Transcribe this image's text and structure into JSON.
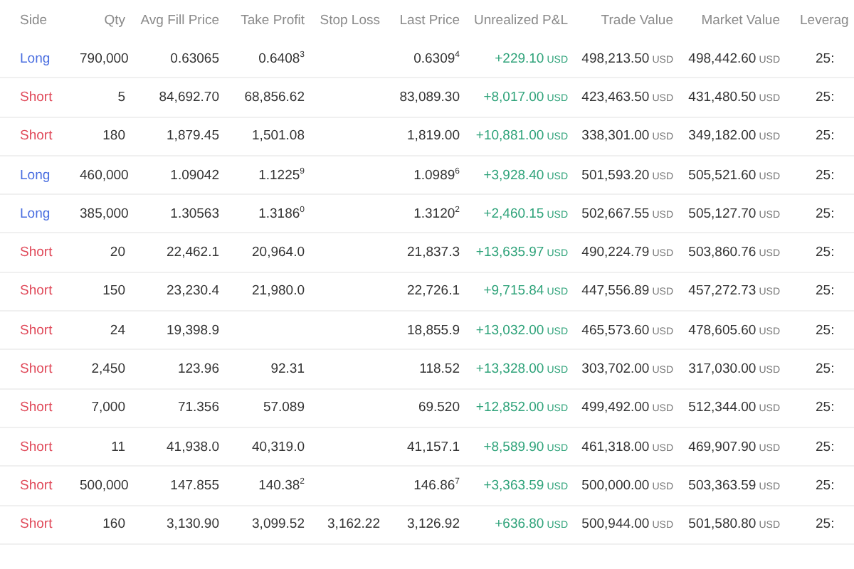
{
  "table": {
    "columns": [
      "Side",
      "Qty",
      "Avg Fill Price",
      "Take Profit",
      "Stop Loss",
      "Last Price",
      "Unrealized P&L",
      "Trade Value",
      "Market Value",
      "Leverag"
    ],
    "rows": [
      {
        "side": "Long",
        "kind": "long",
        "qty": "790,000",
        "avg_fill": "0.63065",
        "take_profit": "0.6408$^{3}$",
        "stop_loss": "",
        "last_price": "0.6309$^{4}$",
        "pnl": "+229.10",
        "pnl_currency": "USD",
        "trade_value": "498,213.50",
        "trade_currency": "USD",
        "market_value": "498,442.60",
        "market_currency": "USD",
        "leverage": "25:"
      },
      {
        "side": "Short",
        "kind": "short",
        "qty": "5",
        "avg_fill": "84,692.70",
        "take_profit": "68,856.62",
        "stop_loss": "",
        "last_price": "83,089.30",
        "pnl": "+8,017.00",
        "pnl_currency": "USD",
        "trade_value": "423,463.50",
        "trade_currency": "USD",
        "market_value": "431,480.50",
        "market_currency": "USD",
        "leverage": "25:"
      },
      {
        "side": "Short",
        "kind": "short",
        "qty": "180",
        "avg_fill": "1,879.45",
        "take_profit": "1,501.08",
        "stop_loss": "",
        "last_price": "1,819.00",
        "pnl": "+10,881.00",
        "pnl_currency": "USD",
        "trade_value": "338,301.00",
        "trade_currency": "USD",
        "market_value": "349,182.00",
        "market_currency": "USD",
        "leverage": "25:"
      },
      {
        "side": "Long",
        "kind": "long",
        "qty": "460,000",
        "avg_fill": "1.09042",
        "take_profit": "1.1225$^{9}$",
        "stop_loss": "",
        "last_price": "1.0989$^{6}$",
        "pnl": "+3,928.40",
        "pnl_currency": "USD",
        "trade_value": "501,593.20",
        "trade_currency": "USD",
        "market_value": "505,521.60",
        "market_currency": "USD",
        "leverage": "25:"
      },
      {
        "side": "Long",
        "kind": "long",
        "qty": "385,000",
        "avg_fill": "1.30563",
        "take_profit": "1.3186$^{0}$",
        "stop_loss": "",
        "last_price": "1.3120$^{2}$",
        "pnl": "+2,460.15",
        "pnl_currency": "USD",
        "trade_value": "502,667.55",
        "trade_currency": "USD",
        "market_value": "505,127.70",
        "market_currency": "USD",
        "leverage": "25:"
      },
      {
        "side": "Short",
        "kind": "short",
        "qty": "20",
        "avg_fill": "22,462.1",
        "take_profit": "20,964.0",
        "stop_loss": "",
        "last_price": "21,837.3",
        "pnl": "+13,635.97",
        "pnl_currency": "USD",
        "trade_value": "490,224.79",
        "trade_currency": "USD",
        "market_value": "503,860.76",
        "market_currency": "USD",
        "leverage": "25:"
      },
      {
        "side": "Short",
        "kind": "short",
        "qty": "150",
        "avg_fill": "23,230.4",
        "take_profit": "21,980.0",
        "stop_loss": "",
        "last_price": "22,726.1",
        "pnl": "+9,715.84",
        "pnl_currency": "USD",
        "trade_value": "447,556.89",
        "trade_currency": "USD",
        "market_value": "457,272.73",
        "market_currency": "USD",
        "leverage": "25:"
      },
      {
        "side": "Short",
        "kind": "short",
        "qty": "24",
        "avg_fill": "19,398.9",
        "take_profit": "",
        "stop_loss": "",
        "last_price": "18,855.9",
        "pnl": "+13,032.00",
        "pnl_currency": "USD",
        "trade_value": "465,573.60",
        "trade_currency": "USD",
        "market_value": "478,605.60",
        "market_currency": "USD",
        "leverage": "25:"
      },
      {
        "side": "Short",
        "kind": "short",
        "qty": "2,450",
        "avg_fill": "123.96",
        "take_profit": "92.31",
        "stop_loss": "",
        "last_price": "118.52",
        "pnl": "+13,328.00",
        "pnl_currency": "USD",
        "trade_value": "303,702.00",
        "trade_currency": "USD",
        "market_value": "317,030.00",
        "market_currency": "USD",
        "leverage": "25:"
      },
      {
        "side": "Short",
        "kind": "short",
        "qty": "7,000",
        "avg_fill": "71.356",
        "take_profit": "57.089",
        "stop_loss": "",
        "last_price": "69.520",
        "pnl": "+12,852.00",
        "pnl_currency": "USD",
        "trade_value": "499,492.00",
        "trade_currency": "USD",
        "market_value": "512,344.00",
        "market_currency": "USD",
        "leverage": "25:"
      },
      {
        "side": "Short",
        "kind": "short",
        "qty": "11",
        "avg_fill": "41,938.0",
        "take_profit": "40,319.0",
        "stop_loss": "",
        "last_price": "41,157.1",
        "pnl": "+8,589.90",
        "pnl_currency": "USD",
        "trade_value": "461,318.00",
        "trade_currency": "USD",
        "market_value": "469,907.90",
        "market_currency": "USD",
        "leverage": "25:"
      },
      {
        "side": "Short",
        "kind": "short",
        "qty": "500,000",
        "avg_fill": "147.855",
        "take_profit": "140.38$^{2}$",
        "stop_loss": "",
        "last_price": "146.86$^{7}$",
        "pnl": "+3,363.59",
        "pnl_currency": "USD",
        "trade_value": "500,000.00",
        "trade_currency": "USD",
        "market_value": "503,363.59",
        "market_currency": "USD",
        "leverage": "25:"
      },
      {
        "side": "Short",
        "kind": "short",
        "qty": "160",
        "avg_fill": "3,130.90",
        "take_profit": "3,099.52",
        "stop_loss": "3,162.22",
        "last_price": "3,126.92",
        "pnl": "+636.80",
        "pnl_currency": "USD",
        "trade_value": "500,944.00",
        "trade_currency": "USD",
        "market_value": "501,580.80",
        "market_currency": "USD",
        "leverage": "25:"
      }
    ]
  }
}
